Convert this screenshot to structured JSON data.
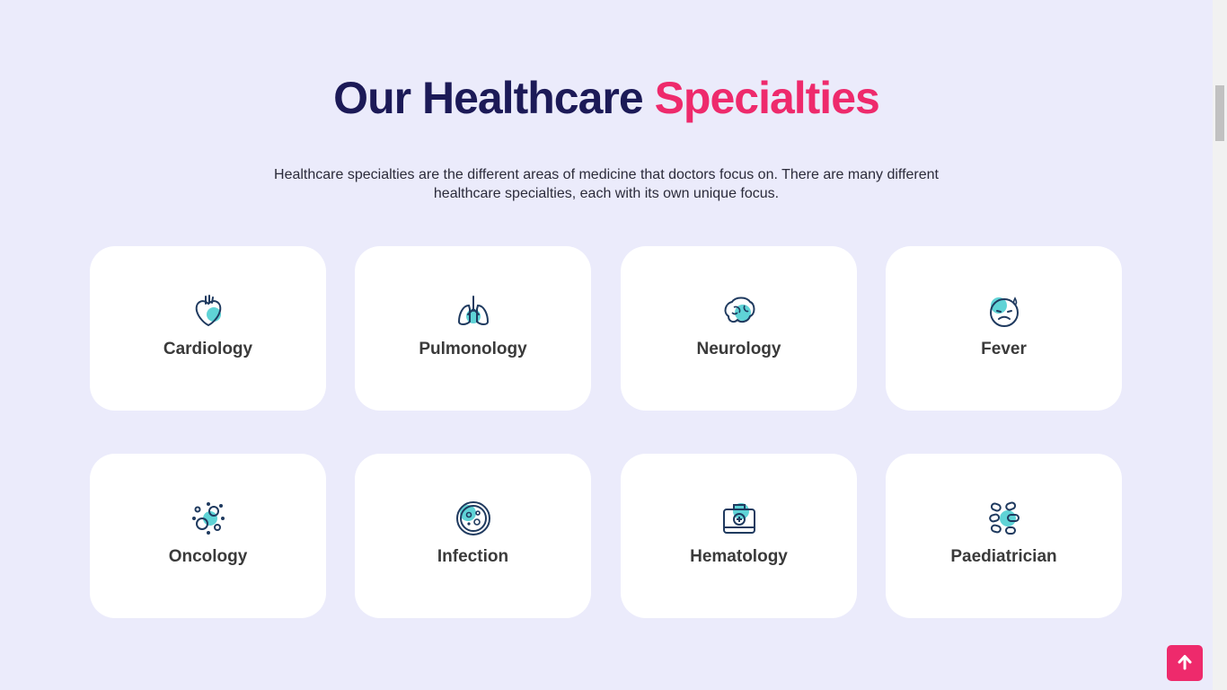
{
  "section": {
    "title_part1": "Our Healthcare",
    "title_part2": "Specialties",
    "description": "Healthcare specialties are the different areas of medicine that doctors focus on. There are many different healthcare specialties, each with its own unique focus."
  },
  "specialties": [
    {
      "label": "Cardiology",
      "icon": "heart-icon"
    },
    {
      "label": "Pulmonology",
      "icon": "lungs-icon"
    },
    {
      "label": "Neurology",
      "icon": "brain-icon"
    },
    {
      "label": "Fever",
      "icon": "sick-face-icon"
    },
    {
      "label": "Oncology",
      "icon": "virus-icon"
    },
    {
      "label": "Infection",
      "icon": "petri-dish-icon"
    },
    {
      "label": "Hematology",
      "icon": "first-aid-kit-icon"
    },
    {
      "label": "Paediatrician",
      "icon": "pills-icon"
    }
  ],
  "colors": {
    "background": "#ebebfb",
    "title_dark": "#1c1a57",
    "accent": "#ee2a6c",
    "icon_stroke": "#1f3a5f",
    "icon_blob": "#5fd3d6"
  },
  "scroll_top_icon": "arrow-up-icon"
}
